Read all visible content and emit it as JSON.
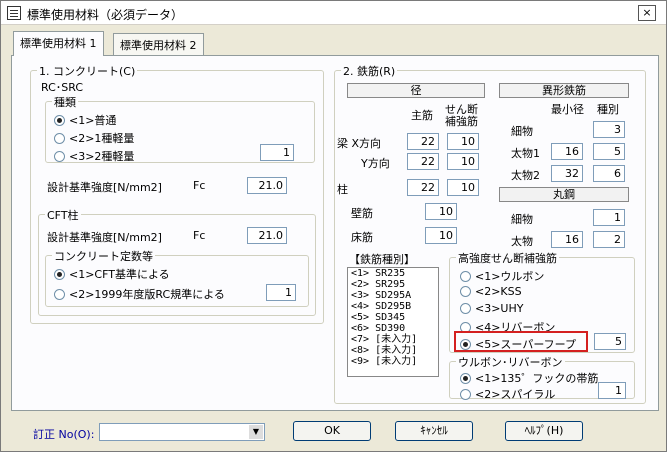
{
  "window": {
    "title": "標準使用材料（必須データ）",
    "close_label": "×"
  },
  "tabs": [
    "標準使用材料 1",
    "標準使用材料 2"
  ],
  "concrete": {
    "title": "1. コンクリート(C)",
    "rc": {
      "title": "RC･SRC",
      "kind_title": "種類",
      "options": [
        "<1>普通",
        "<2>1種軽量",
        "<3>2種軽量"
      ],
      "selected_index": 0,
      "kind_value": "1",
      "strength_label": "設計基準強度[N/mm2]",
      "strength_sym": "Fc",
      "strength_value": "21.0"
    },
    "cft": {
      "title": "CFT柱",
      "strength_label": "設計基準強度[N/mm2]",
      "strength_sym": "Fc",
      "strength_value": "21.0",
      "const_title": "コンクリート定数等",
      "options": [
        "<1>CFT基準による",
        "<2>1999年度版RC規準による"
      ],
      "selected_index": 0,
      "value": "1"
    }
  },
  "rebar": {
    "title": "2. 鉄筋(R)",
    "diameter_header": "径",
    "col_main": "主筋",
    "col_shear_1": "せん断",
    "col_shear_2": "補強筋",
    "rows": [
      {
        "label": "梁 X方向",
        "main": "22",
        "shear": "10"
      },
      {
        "label": "Y方向",
        "main": "22",
        "shear": "10"
      },
      {
        "label": "柱",
        "main": "22",
        "shear": "10"
      }
    ],
    "wall_label": "壁筋",
    "wall_value": "10",
    "floor_label": "床筋",
    "floor_value": "10",
    "deformed": {
      "header": "異形鉄筋",
      "col_min": "最小径",
      "col_kind": "種別",
      "rows": [
        {
          "label": "細物",
          "min": "",
          "kind": "3"
        },
        {
          "label": "太物1",
          "min": "16",
          "kind": "5"
        },
        {
          "label": "太物2",
          "min": "32",
          "kind": "6"
        }
      ]
    },
    "round": {
      "header": "丸鋼",
      "rows": [
        {
          "label": "細物",
          "min": "",
          "kind": "1"
        },
        {
          "label": "太物",
          "min": "16",
          "kind": "2"
        }
      ]
    },
    "types_header": "【鉄筋種別】",
    "types": [
      "<1> SR235",
      "<2> SR295",
      "<3> SD295A",
      "<4> SD295B",
      "<5> SD345",
      "<6> SD390",
      "<7> [未入力]",
      "<8> [未入力]",
      "<9> [未入力]"
    ],
    "high_strength": {
      "title": "高強度せん断補強筋",
      "options": [
        "<1>ウルボン",
        "<2>KSS",
        "<3>UHY",
        "<4>リバーボン",
        "<5>スーパーフープ"
      ],
      "selected_index": 4,
      "value": "5"
    },
    "ulbon": {
      "title": "ウルボン･リバーボン",
      "options": [
        "<1>135゜フックの帯筋",
        "<2>スパイラル"
      ],
      "selected_index": 0,
      "value": "1"
    }
  },
  "footer": {
    "revision_label": "訂正 No(O):",
    "revision_value": "",
    "ok_label": "OK",
    "cancel_label": "ｷｬﾝｾﾙ",
    "help_label": "ﾍﾙﾌﾟ(H)"
  },
  "colors": {
    "highlight": "#d42020",
    "link_text": "#0000a0"
  }
}
